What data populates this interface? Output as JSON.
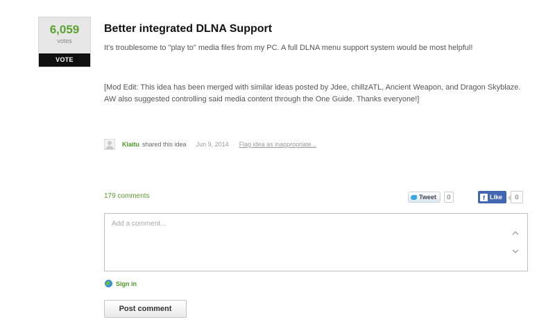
{
  "idea": {
    "votes": "6,059",
    "votes_label": "votes",
    "vote_button": "VOTE",
    "title": "Better integrated DLNA Support",
    "description": "It's troublesome to \"play to\" media files from my PC. A full DLNA menu support system would be most helpful!",
    "mod_edit": "[Mod Edit: This idea has been merged with similar ideas posted by Jdee, chillzATL, Ancient Weapon, and Dragon Skyblaze. AW also suggested controlling said media content through the One Guide. Thanks everyone!]"
  },
  "meta": {
    "author": "Klaitu",
    "shared_text": "shared this idea",
    "date": "Jun 9, 2014",
    "separator": "·",
    "flag_link": "Flag idea as inappropriate..."
  },
  "comments": {
    "count_label": "179 comments",
    "placeholder": "Add a comment...",
    "sign_in": "Sign in",
    "post_button": "Post comment"
  },
  "social": {
    "tweet_label": "Tweet",
    "tweet_count": "0",
    "like_label": "Like",
    "like_count": "0"
  },
  "colors": {
    "accent_green": "#5aa32e",
    "facebook_blue": "#4267b2",
    "twitter_blue": "#3ea8e0"
  },
  "icons": [
    "user-avatar-icon",
    "twitter-bird-icon",
    "facebook-f-icon",
    "chevron-up-icon",
    "chevron-down-icon",
    "globe-icon"
  ]
}
